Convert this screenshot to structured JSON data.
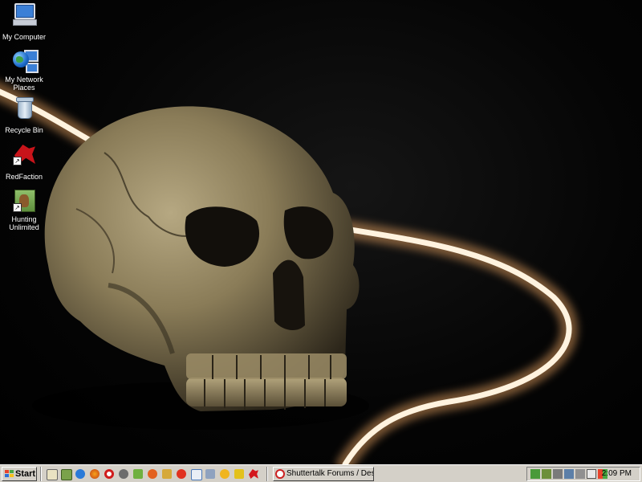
{
  "desktop": {
    "icons": [
      {
        "label_lines": [
          "My Computer"
        ],
        "icon": "my-computer-icon"
      },
      {
        "label_lines": [
          "My Network",
          "Places"
        ],
        "icon": "network-places-icon"
      },
      {
        "label_lines": [
          "Recycle Bin"
        ],
        "icon": "recycle-bin-icon"
      },
      {
        "label_lines": [
          "RedFaction"
        ],
        "icon": "redfaction-icon"
      },
      {
        "label_lines": [
          "Hunting",
          "Unlimited"
        ],
        "icon": "hunting-unlimited-icon"
      }
    ],
    "wallpaper": "skull-wallpaper"
  },
  "taskbar": {
    "start_label": "Start",
    "active_window": "Shuttertalk Forums / Desk...",
    "clock": "2:09 PM",
    "quicklaunch_icons": [
      "show-desktop-icon",
      "photo-app-icon",
      "internet-explorer-icon",
      "firefox-icon",
      "opera-icon",
      "media-icon",
      "search-icon",
      "music-icon",
      "app-icon",
      "media-player-icon",
      "window-icon",
      "network-icon",
      "messenger-icon",
      "security-icon",
      "redfaction-icon"
    ],
    "tray_icons": [
      "network-tray-icon",
      "volume-tray-icon",
      "display-tray-icon",
      "monitor-tray-icon",
      "print-tray-icon",
      "security-tray-icon",
      "windows-tray-icon"
    ]
  },
  "colors": {
    "taskbar": "#d4d0c8",
    "desktop_bg": "#000000",
    "light_streak": "#fff2dc"
  }
}
